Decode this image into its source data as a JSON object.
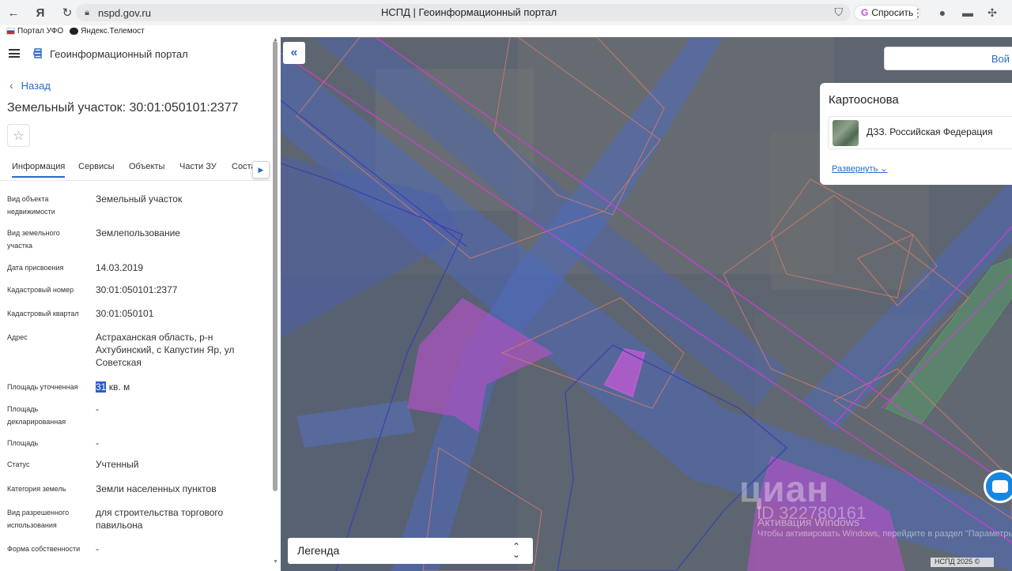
{
  "browser": {
    "url": "nspd.gov.ru",
    "tab_title": "НСПД | Геоинформационный портал",
    "ask_label": "Спросить",
    "bookmarks": [
      "Портал УФО",
      "Яндекс.Телемост"
    ]
  },
  "portal": {
    "name": "Геоинформационный портал"
  },
  "panel": {
    "back_label": "Назад",
    "title": "Земельный участок: 30:01:050101:2377",
    "tabs": [
      "Информация",
      "Сервисы",
      "Объекты",
      "Части ЗУ",
      "Соста"
    ],
    "fields": [
      {
        "label": "Вид объекта недвижимости",
        "value": "Земельный участок"
      },
      {
        "label": "Вид земельного участка",
        "value": "Землепользование"
      },
      {
        "label": "Дата присвоения",
        "value": "14.03.2019"
      },
      {
        "label": "Кадастровый номер",
        "value": "30:01:050101:2377"
      },
      {
        "label": "Кадастровый квартал",
        "value": "30:01:050101"
      },
      {
        "label": "Адрес",
        "value": "Астраханская область, р-н Ахтубинский, с Капустин Яр, ул Советская"
      },
      {
        "label": "Площадь уточненная",
        "value_selected": "31",
        "value_rest": " кв. м"
      },
      {
        "label": "Площадь декларированная",
        "value": "-"
      },
      {
        "label": "Площадь",
        "value": "-"
      },
      {
        "label": "Статус",
        "value": "Учтенный"
      },
      {
        "label": "Категория земель",
        "value": "Земли населенных пунктов"
      },
      {
        "label": "Вид разрешенного использования",
        "value": "для строительства торгового павильона"
      },
      {
        "label": "Форма собственности",
        "value": "-"
      }
    ]
  },
  "map": {
    "login_label": "Вой",
    "basemap": {
      "title": "Картооснова",
      "selected": "ДЗЗ. Российская Федерация",
      "expand_label": "Развернуть"
    },
    "legend_label": "Легенда",
    "watermark": {
      "text": "циан",
      "id": "ID 322780161"
    },
    "windows_activation": {
      "title": "Активация Windows",
      "subtitle": "Чтобы активировать Windows, перейдите в раздел \"Параметры\"."
    },
    "copyright": "НСПД 2025 ©"
  },
  "colors": {
    "accent": "#2a68c9",
    "parcel_magenta": "#c548d4",
    "parcel_green": "#45d45a"
  }
}
